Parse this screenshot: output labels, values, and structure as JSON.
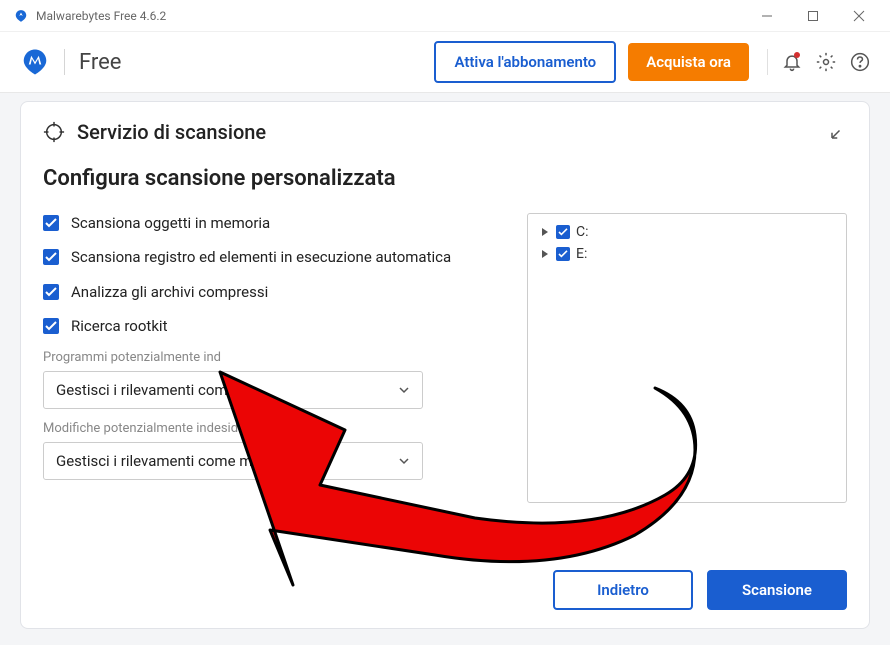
{
  "titlebar": {
    "title": "Malwarebytes Free  4.6.2"
  },
  "appbar": {
    "product": "Free",
    "activate": "Attiva l'abbonamento",
    "buy": "Acquista ora"
  },
  "card": {
    "title": "Servizio di scansione",
    "section": "Configura scansione personalizzata",
    "checks": [
      "Scansiona oggetti in memoria",
      "Scansiona registro ed elementi in esecuzione automatica",
      "Analizza gli archivi compressi",
      "Ricerca rootkit"
    ],
    "pupLabel": "Programmi potenzialmente ind",
    "pupValue": "Gestisci i rilevamenti come m",
    "pumLabel": "Modifiche potenzialmente indesiderate (P",
    "pumValue": "Gestisci i rilevamenti come malware",
    "drives": [
      "C:",
      "E:"
    ],
    "back": "Indietro",
    "scan": "Scansione"
  }
}
